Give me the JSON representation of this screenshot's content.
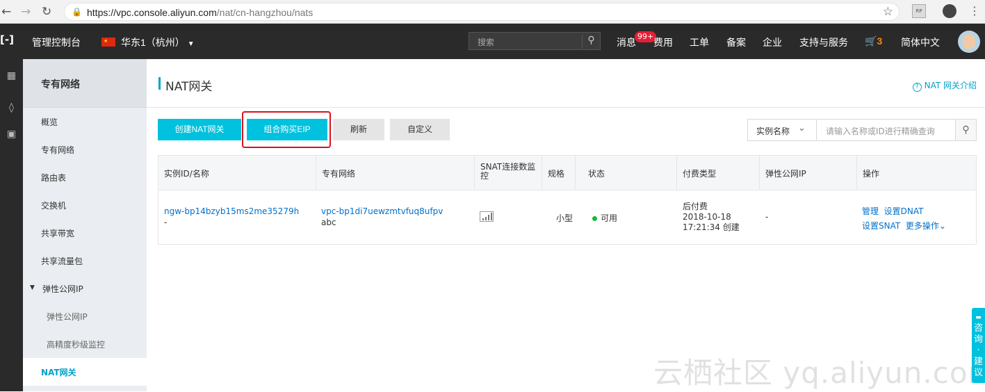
{
  "browser": {
    "url_host": "https://vpc.console.aliyun.com",
    "url_path": "/nat/cn-hangzhou/nats"
  },
  "topnav": {
    "console": "管理控制台",
    "region": "华东1（杭州）",
    "search_placeholder": "搜索",
    "messages": "消息",
    "messages_badge": "99+",
    "items": [
      "费用",
      "工单",
      "备案",
      "企业",
      "支持与服务"
    ],
    "cart_count": "3",
    "language": "简体中文"
  },
  "sidebar": {
    "title": "专有网络",
    "items": [
      {
        "label": "概览"
      },
      {
        "label": "专有网络"
      },
      {
        "label": "路由表"
      },
      {
        "label": "交换机"
      },
      {
        "label": "共享带宽"
      },
      {
        "label": "共享流量包"
      },
      {
        "label": "弹性公网IP"
      },
      {
        "label": "弹性公网IP"
      },
      {
        "label": "高精度秒级监控"
      },
      {
        "label": "NAT网关"
      }
    ]
  },
  "main": {
    "title": "NAT网关",
    "help_link": "NAT 网关介绍",
    "buttons": {
      "create": "创建NAT网关",
      "buy_eip": "组合购买EIP",
      "refresh": "刷新",
      "customize": "自定义"
    },
    "filter": {
      "select_value": "实例名称",
      "placeholder": "请输入名称或ID进行精确查询"
    },
    "table": {
      "headers": [
        "实例ID/名称",
        "专有网络",
        "SNAT连接数监控",
        "规格",
        "状态",
        "付费类型",
        "弹性公网IP",
        "操作"
      ],
      "rows": [
        {
          "instance_id": "ngw-bp14bzyb15ms2me35279h",
          "instance_name": "-",
          "vpc_id": "vpc-bp1di7uewzmtvfuq8ufpv",
          "vpc_name": "abc",
          "spec": "小型",
          "status": "可用",
          "pay_type": "后付费",
          "created_date": "2018-10-18",
          "created_time": "17:21:34 创建",
          "eip": "-",
          "actions": {
            "manage": "管理",
            "set_dnat": "设置DNAT",
            "set_snat": "设置SNAT",
            "more": "更多操作"
          }
        }
      ]
    }
  },
  "consult": "咨询·建议",
  "watermark": "云栖社区 yq.aliyun.com",
  "colors": {
    "accent": "#00c1de",
    "link": "#0070cc",
    "nav_bg": "#2a2a2a",
    "highlight": "#d6141f",
    "status_ok": "#16b83b"
  }
}
